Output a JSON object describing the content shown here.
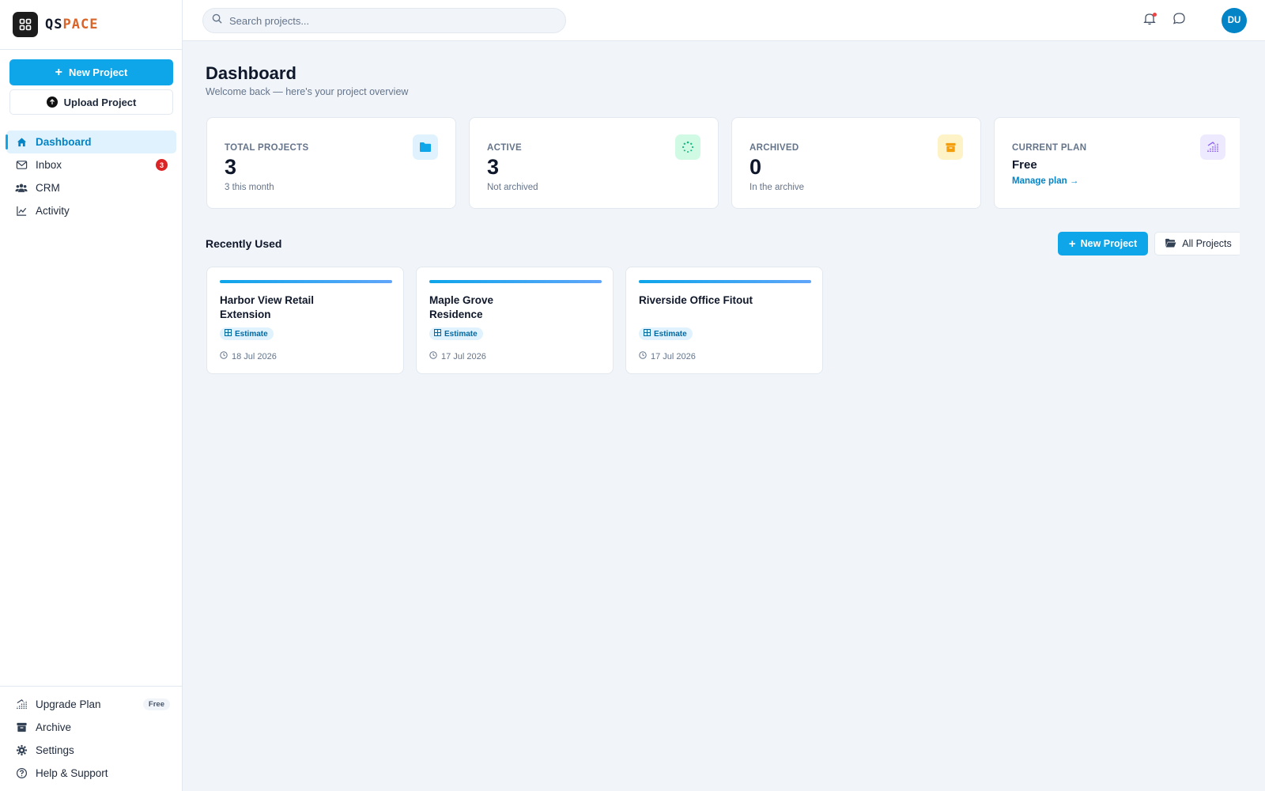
{
  "brand": {
    "name_part1": "QS",
    "name_part2": "PACE"
  },
  "sidebar": {
    "new_project_label": "New Project",
    "upload_project_label": "Upload Project",
    "items": [
      {
        "label": "Dashboard",
        "icon": "home-icon",
        "active": true
      },
      {
        "label": "Inbox",
        "icon": "mail-icon",
        "badge": "3"
      },
      {
        "label": "CRM",
        "icon": "users-icon"
      },
      {
        "label": "Activity",
        "icon": "chart-line-icon"
      }
    ],
    "bottom_items": [
      {
        "label": "Upgrade Plan",
        "icon": "upgrade-icon",
        "pill": "Free"
      },
      {
        "label": "Archive",
        "icon": "archive-icon"
      },
      {
        "label": "Settings",
        "icon": "gear-icon"
      },
      {
        "label": "Help & Support",
        "icon": "help-icon"
      }
    ]
  },
  "topbar": {
    "search_placeholder": "Search projects...",
    "avatar_initials": "DU"
  },
  "main": {
    "title": "Dashboard",
    "subtitle": "Welcome back — here's your project overview",
    "stats": [
      {
        "label": "TOTAL PROJECTS",
        "value": "3",
        "sub": "3 this month",
        "icon": "folder-icon",
        "color": "#0ea5e9"
      },
      {
        "label": "ACTIVE",
        "value": "3",
        "sub": "Not archived",
        "icon": "spinner-icon",
        "color": "#10b981"
      },
      {
        "label": "ARCHIVED",
        "value": "0",
        "sub": "In the archive",
        "icon": "archive-box-icon",
        "color": "#f59e0b"
      },
      {
        "label": "CURRENT PLAN",
        "value": "Free",
        "link": "Manage plan →",
        "icon": "plan-icon",
        "color": "#8b5cf6"
      }
    ],
    "recent_title": "Recently Used",
    "new_project_label": "New Project",
    "all_projects_label": "All Projects",
    "projects": [
      {
        "name": "Harbor View Retail Extension",
        "tag": "Estimate",
        "date": "18 Jul 2026"
      },
      {
        "name": "Maple Grove Residence",
        "tag": "Estimate",
        "date": "17 Jul 2026"
      },
      {
        "name": "Riverside Office Fitout",
        "tag": "Estimate",
        "date": "17 Jul 2026"
      }
    ]
  },
  "colors": {
    "accent": "#0ea5e9",
    "brand_orange": "#d9652a",
    "badge_red": "#dc2626"
  }
}
